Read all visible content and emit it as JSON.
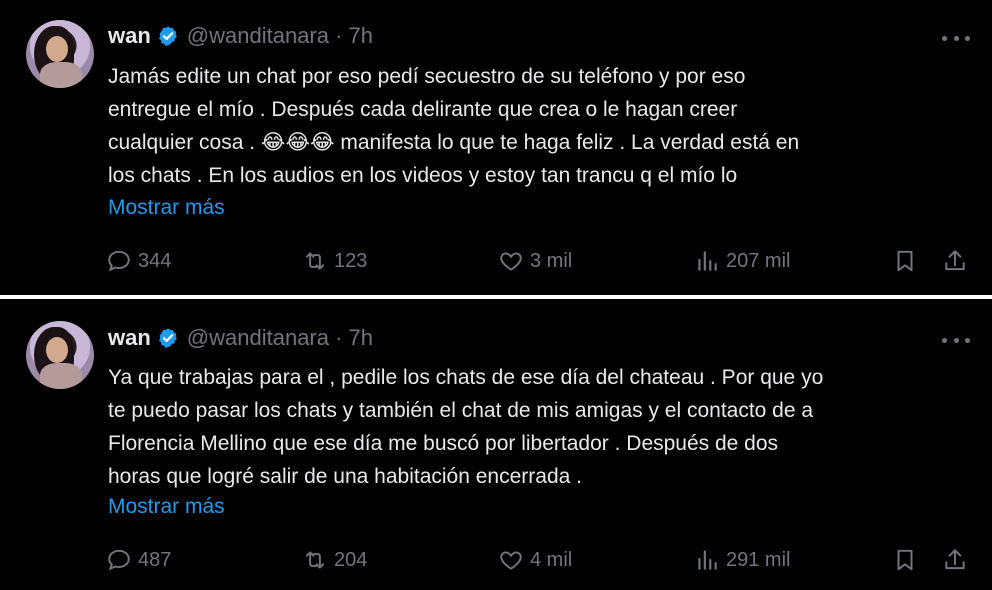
{
  "tweets": [
    {
      "name": "wan",
      "handle": "@wanditanara · 7h",
      "text": "Jamás edite un chat por eso pedí secuestro de su teléfono y por eso\nentregue el mío . Después cada delirante que crea o le hagan creer\ncualquier cosa . 😂😂😂 manifesta lo que te haga feliz . La verdad está en\nlos chats . En los audios en los videos y estoy tan trancu q el mío lo",
      "show_more": "Mostrar más",
      "replies": "344",
      "reposts": "123",
      "likes": "3 mil",
      "views": "207 mil"
    },
    {
      "name": "wan",
      "handle": "@wanditanara · 7h",
      "text": "Ya que trabajas para el , pedile los chats de ese día del chateau . Por que yo\nte puedo pasar los chats y también el chat de mis amigas y el contacto de a\nFlorencia Mellino que ese día me buscó por libertador . Después de dos\nhoras que logré salir de una habitación encerrada .",
      "show_more": "Mostrar más",
      "replies": "487",
      "reposts": "204",
      "likes": "4 mil",
      "views": "291 mil"
    }
  ],
  "icons": {
    "verified": "verified-badge-icon",
    "more": "more-icon",
    "reply": "reply-icon",
    "repost": "repost-icon",
    "like": "like-icon",
    "views": "views-icon",
    "bookmark": "bookmark-icon",
    "share": "share-icon"
  },
  "colors": {
    "background": "#000000",
    "text": "#e7e9ea",
    "muted": "#71767b",
    "link": "#1d9bf0",
    "verified": "#1d9bf0"
  }
}
